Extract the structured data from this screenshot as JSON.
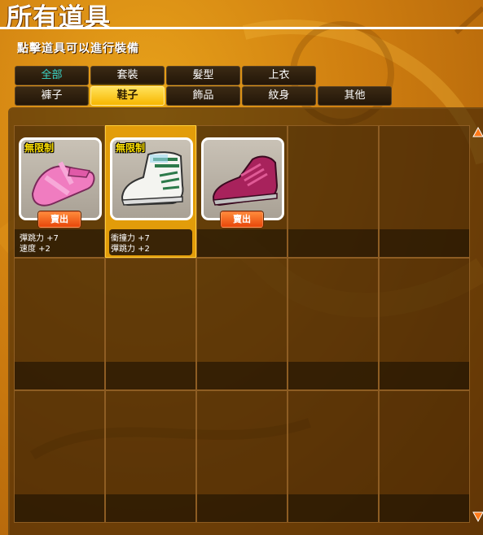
{
  "header": {
    "title": "所有道具",
    "subtitle": "點擊道具可以進行裝備"
  },
  "tabs": [
    {
      "label": "全部"
    },
    {
      "label": "套裝"
    },
    {
      "label": "髮型"
    },
    {
      "label": "上衣"
    },
    {
      "label": "褲子"
    },
    {
      "label": "鞋子"
    },
    {
      "label": "飾品"
    },
    {
      "label": "紋身"
    },
    {
      "label": "其他"
    }
  ],
  "selected_tab": "鞋子",
  "items": [
    {
      "name_icon": "pink-sandal-icon",
      "tag": "無限制",
      "sell_label": "賣出",
      "stats": [
        "彈跳力 +7",
        "速度 +2"
      ]
    },
    {
      "name_icon": "white-green-sneaker-icon",
      "tag": "無限制",
      "stats": [
        "衝撞力 +7",
        "彈跳力 +2"
      ]
    },
    {
      "name_icon": "magenta-sneaker-icon",
      "sell_label": "賣出",
      "stats": []
    }
  ],
  "colors": {
    "accent": "#f7b600",
    "tab_active_text": "#3ad6c8",
    "sell_button": "#e8470a",
    "limit_tag": "#ffe100"
  }
}
